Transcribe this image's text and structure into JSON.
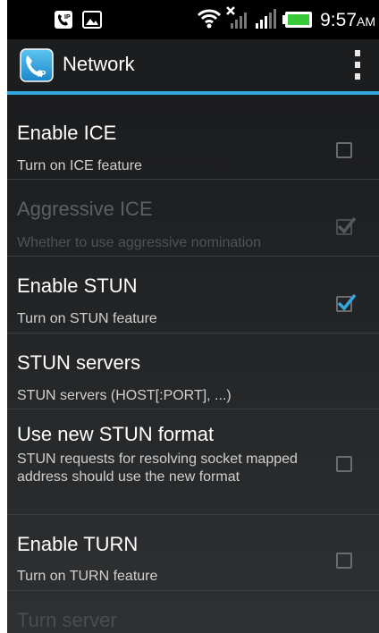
{
  "status_bar": {
    "time": "9:57",
    "ampm": "AM",
    "icons": [
      "ip-call-notification-icon",
      "image-notification-icon",
      "wifi-icon",
      "no-data-signal-icon",
      "cell-signal-icon",
      "battery-icon"
    ]
  },
  "action_bar": {
    "title": "Network",
    "app_icon": "ip-phone-icon",
    "overflow_icon": "overflow-menu-icon"
  },
  "colors": {
    "accent": "#35a7de",
    "battery": "#37c938"
  },
  "preferences": [
    {
      "title": "Enable ICE",
      "summary": "Turn on ICE feature",
      "checkbox": true,
      "checked": false,
      "enabled": true
    },
    {
      "title": "Aggressive ICE",
      "summary": "Whether to use aggressive nomination",
      "checkbox": true,
      "checked": true,
      "enabled": false
    },
    {
      "title": "Enable STUN",
      "summary": "Turn on STUN feature",
      "checkbox": true,
      "checked": true,
      "enabled": true
    },
    {
      "title": "STUN servers",
      "summary": "STUN servers (HOST[:PORT], ...)",
      "checkbox": false,
      "enabled": true
    },
    {
      "title": "Use new STUN format",
      "summary": "STUN requests for resolving socket mapped address should use the new format",
      "checkbox": true,
      "checked": false,
      "enabled": true
    },
    {
      "title": "Enable TURN",
      "summary": "Turn on TURN feature",
      "checkbox": true,
      "checked": false,
      "enabled": true
    },
    {
      "title": "Turn server",
      "summary": "",
      "checkbox": false,
      "enabled": false
    }
  ]
}
